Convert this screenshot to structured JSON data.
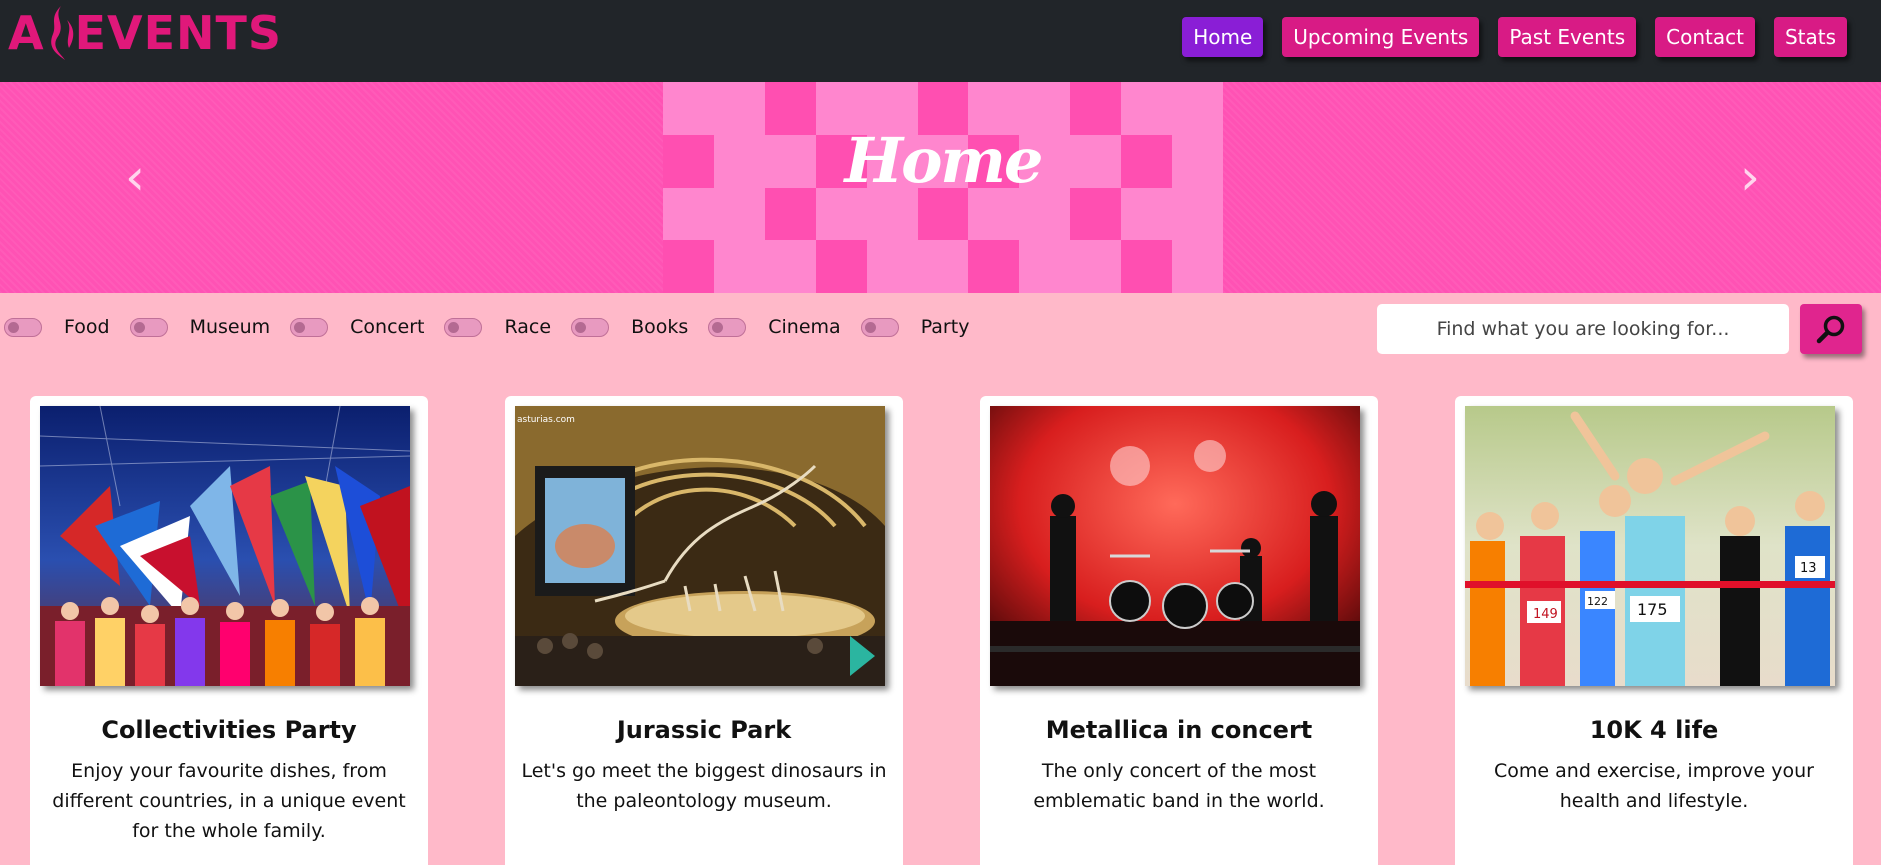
{
  "brand": {
    "logo_text_a": "A",
    "logo_text_rest": "EVENTS",
    "color": "#e0187a"
  },
  "nav": {
    "items": [
      {
        "label": "Home",
        "active": true
      },
      {
        "label": "Upcoming Events",
        "active": false
      },
      {
        "label": "Past Events",
        "active": false
      },
      {
        "label": "Contact",
        "active": false
      },
      {
        "label": "Stats",
        "active": false
      }
    ]
  },
  "hero": {
    "title": "Home",
    "prev_icon": "chevron-left-icon",
    "next_icon": "chevron-right-icon",
    "prev_glyph": "‹",
    "next_glyph": "›"
  },
  "filters": [
    {
      "label": "Food",
      "checked": false
    },
    {
      "label": "Museum",
      "checked": false
    },
    {
      "label": "Concert",
      "checked": false
    },
    {
      "label": "Race",
      "checked": false
    },
    {
      "label": "Books",
      "checked": false
    },
    {
      "label": "Cinema",
      "checked": false
    },
    {
      "label": "Party",
      "checked": false
    }
  ],
  "search": {
    "placeholder": "Find what you are looking for...",
    "value": "",
    "icon": "magnifier-icon"
  },
  "cards": [
    {
      "title": "Collectivities Party",
      "description": "Enjoy your favourite dishes, from different countries, in a unique event for the whole family.",
      "image": "flags-festival-photo"
    },
    {
      "title": "Jurassic Park",
      "description": "Let's go meet the biggest dinosaurs in the paleontology museum.",
      "image": "dinosaur-museum-photo",
      "image_caption": "asturias.com"
    },
    {
      "title": "Metallica in concert",
      "description": "The only concert of the most emblematic band in the world.",
      "image": "rock-concert-photo"
    },
    {
      "title": "10K 4 life",
      "description": "Come and exercise, improve your health and lifestyle.",
      "image": "running-race-photo",
      "bibs": [
        "149",
        "175",
        "13",
        "122"
      ]
    }
  ],
  "colors": {
    "navbar": "#212529",
    "nav_button": "#d81b85",
    "nav_active": "#8a1ed6",
    "page_bg": "#ffb9c9",
    "hero_bg": "#ff52b4",
    "search_button": "#e0258e"
  }
}
